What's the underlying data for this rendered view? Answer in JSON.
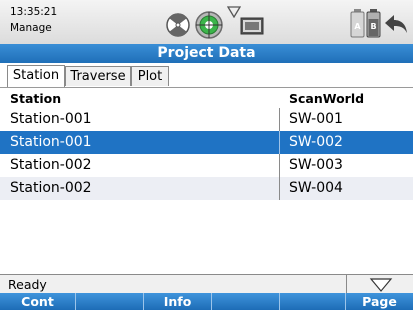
{
  "statusbar": {
    "time": "13:35:21",
    "mode": "Manage",
    "icons": [
      "survey-prism-icon",
      "target-reticle-icon",
      "wlan-signal-icon",
      "memory-card-icon",
      "battery-a-icon",
      "battery-b-icon",
      "back-arrow-icon"
    ]
  },
  "title": "Project Data",
  "tabs": [
    {
      "label": "Station",
      "active": true
    },
    {
      "label": "Traverse",
      "active": false
    },
    {
      "label": "Plot",
      "active": false
    }
  ],
  "table": {
    "headers": [
      "Station",
      "ScanWorld"
    ],
    "rows": [
      {
        "station": "Station-001",
        "scanworld": "SW-001"
      },
      {
        "station": "Station-001",
        "scanworld": "SW-002"
      },
      {
        "station": "Station-002",
        "scanworld": "SW-003"
      },
      {
        "station": "Station-002",
        "scanworld": "SW-004"
      }
    ],
    "selected_row": 2
  },
  "status_line": {
    "text": "Ready",
    "dropdown_icon": "triangle-down-icon"
  },
  "softkeys": [
    "Cont",
    "",
    "Info",
    "",
    "",
    "Page"
  ],
  "colors": {
    "accent": "#1f73c4",
    "title_bar": "#2a7fca",
    "alt_row": "#eceef4"
  }
}
